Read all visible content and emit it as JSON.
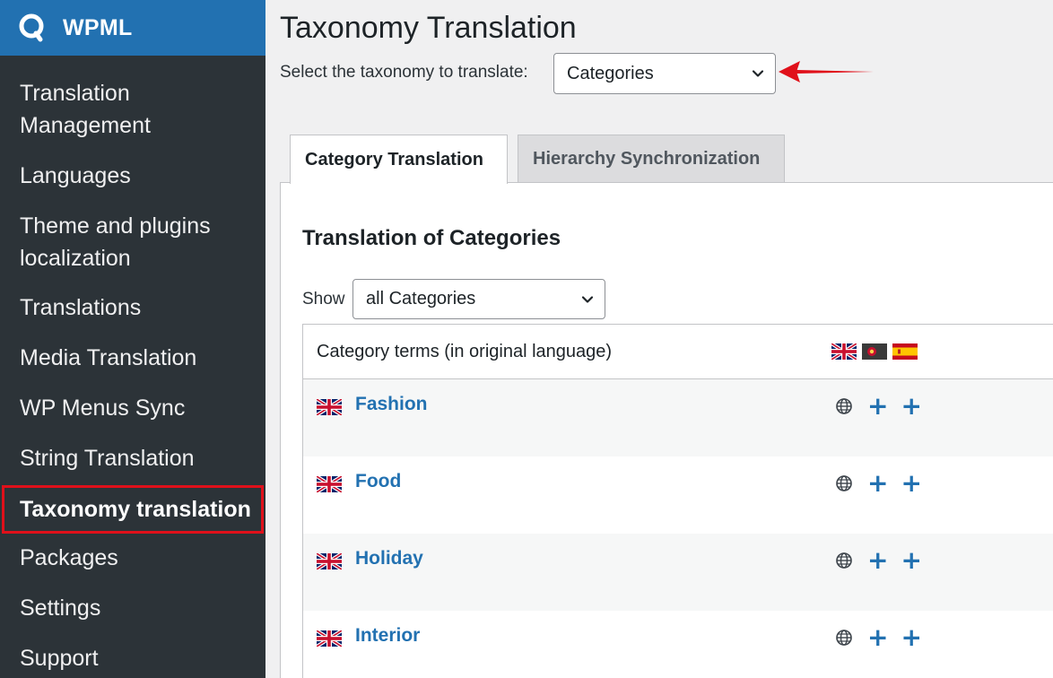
{
  "brand": {
    "name": "WPML"
  },
  "sidebar": {
    "items": [
      {
        "label": "Translation Management"
      },
      {
        "label": "Languages"
      },
      {
        "label": "Theme and plugins localization"
      },
      {
        "label": "Translations"
      },
      {
        "label": "Media Translation"
      },
      {
        "label": "WP Menus Sync"
      },
      {
        "label": "String Translation"
      },
      {
        "label": "Taxonomy translation",
        "current": true
      },
      {
        "label": "Packages"
      },
      {
        "label": "Settings"
      },
      {
        "label": "Support"
      }
    ]
  },
  "header": {
    "title": "Taxonomy Translation",
    "select_label": "Select the taxonomy to translate:",
    "taxonomy_selected": "Categories"
  },
  "tabs": [
    {
      "label": "Category Translation",
      "active": true
    },
    {
      "label": "Hierarchy Synchronization",
      "active": false
    }
  ],
  "panel": {
    "title": "Translation of Categories",
    "show_label": "Show",
    "filter_selected": "all Categories",
    "table": {
      "column_header": "Category terms (in original language)",
      "language_flags": [
        "uk-flag-icon",
        "portugal-flag-icon",
        "spain-flag-icon"
      ],
      "rows": [
        {
          "term": "Fashion"
        },
        {
          "term": "Food"
        },
        {
          "term": "Holiday"
        },
        {
          "term": "Interior"
        }
      ]
    }
  },
  "colors": {
    "sidebar_bg": "#2c3338",
    "brand_bg": "#2271b1",
    "link": "#2271b1",
    "highlight_border": "#e0101a",
    "arrow": "#e0101a"
  }
}
